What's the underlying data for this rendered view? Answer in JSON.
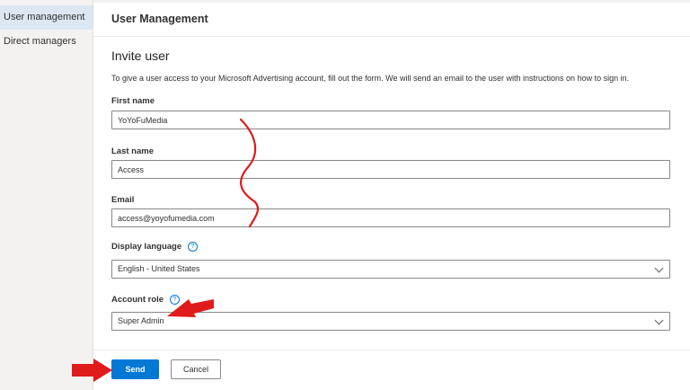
{
  "sidebar": {
    "items": [
      {
        "label": "User management",
        "active": true
      },
      {
        "label": "Direct managers",
        "active": false
      }
    ]
  },
  "header": {
    "title": "User Management"
  },
  "form": {
    "title": "Invite user",
    "description": "To give a user access to your Microsoft Advertising account, fill out the form. We will send an email to the user with instructions on how to sign in.",
    "first_name": {
      "label": "First name",
      "value": "YoYoFuMedia"
    },
    "last_name": {
      "label": "Last name",
      "value": "Access"
    },
    "email": {
      "label": "Email",
      "value": "access@yoyofumedia.com"
    },
    "display_language": {
      "label": "Display language",
      "value": "English - United States"
    },
    "account_role": {
      "label": "Account role",
      "value": "Super Admin"
    },
    "info_glyph": "?"
  },
  "actions": {
    "send_label": "Send",
    "cancel_label": "Cancel"
  },
  "colors": {
    "primary": "#0078d4",
    "annotation": "#e01b1b",
    "sidebar_active": "#dde6f3"
  },
  "icons": [
    "info-icon",
    "chevron-down-icon",
    "annotation-arrow-icon"
  ]
}
